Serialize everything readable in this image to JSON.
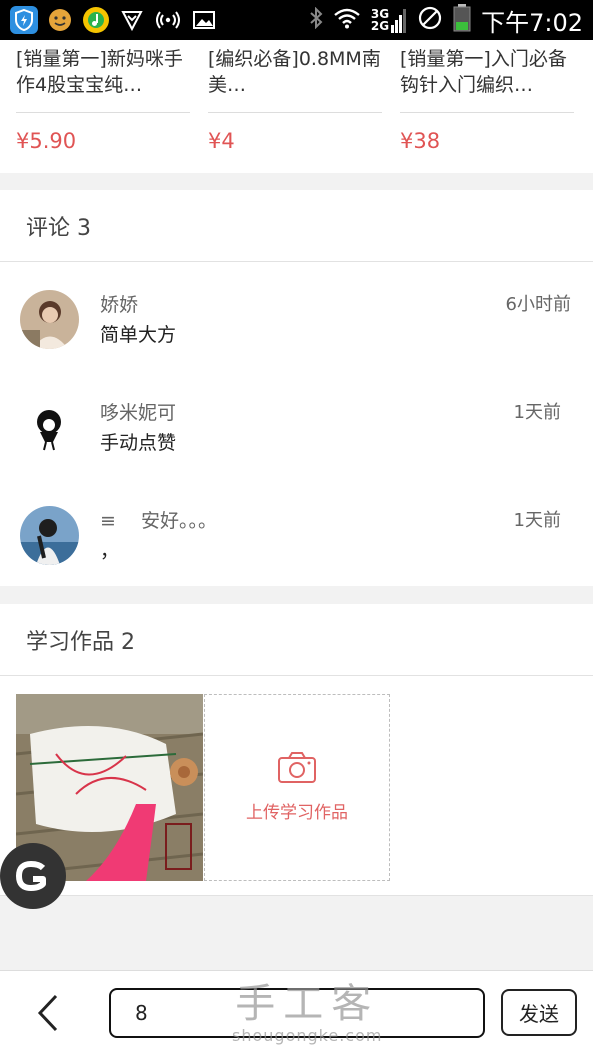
{
  "status_bar": {
    "time": "下午7:02",
    "net_top": "3G",
    "net_bottom": "2G"
  },
  "products": [
    {
      "title": "[销量第一]新妈咪手作4股宝宝纯…",
      "price": "¥5.90"
    },
    {
      "title": "[编织必备]0.8MM南美…",
      "price": "¥4"
    },
    {
      "title": "[销量第一]入门必备 钩针入门编织…",
      "price": "¥38"
    }
  ],
  "comments_section": {
    "header": "评论 3",
    "items": [
      {
        "name": "娇娇",
        "text": "简单大方",
        "time": "6小时前"
      },
      {
        "name": "哆米妮可",
        "text": "手动点赞",
        "time": "1天前"
      },
      {
        "name": "≡　 安好。。。",
        "text": "，",
        "time": "1天前"
      }
    ]
  },
  "works_section": {
    "header": "学习作品 2",
    "upload_label": "上传学习作品"
  },
  "bottom_bar": {
    "input_value": "8",
    "send_label": "发送"
  },
  "watermark": {
    "brand": "手工客",
    "url": "shougongke.com"
  },
  "colors": {
    "price": "#e05454",
    "accent": "#e06363"
  }
}
